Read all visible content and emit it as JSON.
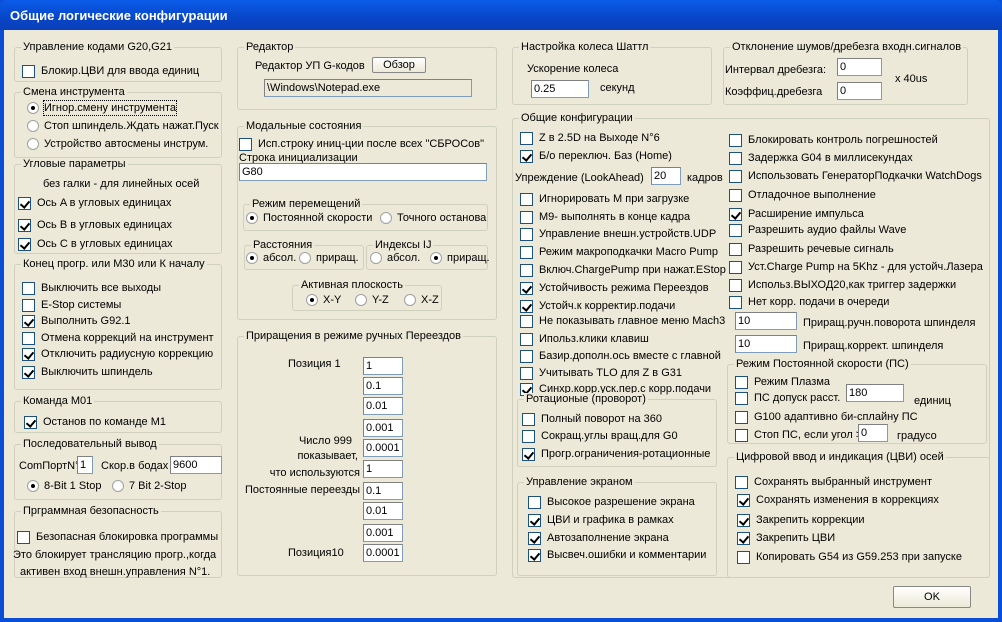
{
  "window": {
    "title": "Общие логические конфигурации"
  },
  "g20": {
    "title": "Управление кодами G20,G21",
    "items": [
      {
        "label": "Блокир.ЦВИ для ввода единиц",
        "checked": false
      }
    ]
  },
  "tool": {
    "title": "Смена инструмента",
    "items": [
      {
        "label": "Игнор.смену инструмента",
        "checked": true
      },
      {
        "label": "Стоп шпиндель.Ждать нажат.Пуск",
        "checked": false
      },
      {
        "label": "Устройство автосмены инструм.",
        "checked": false
      }
    ]
  },
  "angular": {
    "title": "Угловые параметры",
    "subtitle": "без галки - для линейных осей",
    "items": [
      {
        "label": "Ось A в угловых единицах",
        "checked": true
      },
      {
        "label": "Ось B в угловых единицах",
        "checked": true
      },
      {
        "label": "Ось C в угловых единицах",
        "checked": true
      }
    ]
  },
  "endprog": {
    "title": "Конец прогр. или M30 или К началу",
    "items": [
      {
        "label": "Выключить все выходы",
        "checked": false
      },
      {
        "label": "E-Stop системы",
        "checked": false
      },
      {
        "label": "Выполнить G92.1",
        "checked": true
      },
      {
        "label": "Отмена коррекций на инструмент",
        "checked": false
      },
      {
        "label": "Отключить радиусную коррекцию",
        "checked": true
      },
      {
        "label": "Выключить шпиндель",
        "checked": true
      }
    ]
  },
  "m01": {
    "title": "Команда M01",
    "items": [
      {
        "label": "Останов по команде M1",
        "checked": true
      }
    ]
  },
  "serial": {
    "title": "Последовательный вывод",
    "port_label": "ComПортN°",
    "port": "1",
    "baud_label": "Скор.в бодах",
    "baud": "9600",
    "items": [
      {
        "label": "8-Bit 1 Stop",
        "checked": true
      },
      {
        "label": "7 Bit 2-Stop",
        "checked": false
      }
    ]
  },
  "security": {
    "title": "Прграммная безопасность",
    "items": [
      {
        "label": "Безопасная блокировка программы",
        "checked": false
      }
    ],
    "note1": "Это блокирует трансляцию прогр.,когда",
    "note2": "активен вход внешн.управления N°1."
  },
  "editor": {
    "title": "Редактор",
    "label": "Редактор УП G-кодов",
    "browse": "Обзор",
    "path": "\\Windows\\Notepad.exe"
  },
  "modal": {
    "title": "Модальные состояния",
    "items": [
      {
        "label": "Исп.строку иниц-ции после всех \"СБРОСов\"",
        "checked": false
      }
    ],
    "init_label": "Строка инициализации",
    "init": "G80",
    "motion": {
      "title": "Режим перемещений",
      "items": [
        {
          "label": "Постоянной скорости",
          "checked": true
        },
        {
          "label": "Точного останова",
          "checked": false
        }
      ]
    },
    "dist": {
      "title": "Расстояния",
      "items": [
        {
          "label": "абсол.",
          "checked": true
        },
        {
          "label": "приращ.",
          "checked": false
        }
      ]
    },
    "ij": {
      "title": "Индексы IJ",
      "items": [
        {
          "label": "абсол.",
          "checked": false
        },
        {
          "label": "приращ.",
          "checked": true
        }
      ]
    },
    "plane": {
      "title": "Активная плоскость",
      "items": [
        {
          "label": "X-Y",
          "checked": true
        },
        {
          "label": "Y-Z",
          "checked": false
        },
        {
          "label": "X-Z",
          "checked": false
        }
      ]
    }
  },
  "jog": {
    "title": "Приращения в режиме ручных Переездов",
    "pos1": "Позиция 1",
    "note": [
      "Число 999",
      "показывает,",
      "что используются",
      "Постоянные переезды"
    ],
    "pos10": "Позиция10",
    "values": [
      "1",
      "0.1",
      "0.01",
      "0.001",
      "0.0001",
      "1",
      "0.1",
      "0.01",
      "0.001",
      "0.0001"
    ]
  },
  "shuttle": {
    "title": "Настройка колеса Шаттл",
    "label": "Ускорение колеса",
    "value": "0.25",
    "unit": "секунд"
  },
  "debounce": {
    "title": "Отклонение шумов/дребезга входн.сигналов",
    "interval_label": "Интервал дребезга:",
    "interval": "0",
    "coef_label": "Коэффиц.дребезга",
    "coef": "0",
    "unit": "x 40us"
  },
  "general": {
    "title": "Общие конфигурации",
    "left": [
      {
        "label": "Z в 2.5D на Выходе N°6",
        "checked": false
      },
      {
        "label": "Б/о переключ. Баз (Home)",
        "checked": true
      },
      {
        "label": "Игнорировать M при загрузке",
        "checked": false
      },
      {
        "label": "M9- выполнять в конце кадра",
        "checked": false
      },
      {
        "label": "Управление внешн.устройств.UDP",
        "checked": false
      },
      {
        "label": "Режим макроподкачки Macro Pump",
        "checked": false
      },
      {
        "label": "Включ.ChargePump при нажат.EStop",
        "checked": false
      },
      {
        "label": "Устойчивость режима Переездов",
        "checked": true
      },
      {
        "label": "Устойч.к корректир.подачи",
        "checked": true
      },
      {
        "label": "Не показывать главное меню Mach3",
        "checked": false
      },
      {
        "label": "Ипольз.клики клавиш",
        "checked": false
      },
      {
        "label": "Базир.дополн.ось вместе с главной",
        "checked": false
      },
      {
        "label": "Учитывать TLO для Z в G31",
        "checked": false
      },
      {
        "label": "Синхр.корр.уск.пер.с корр.подачи",
        "checked": true
      }
    ],
    "lookahead_label": "Упреждение (LookAhead)",
    "lookahead": "20",
    "lookahead_unit": "кадров",
    "right": [
      {
        "label": "Блокировать контроль погрешностей",
        "checked": false
      },
      {
        "label": "Задержка G04 в миллисекундах",
        "checked": false
      },
      {
        "label": "Использовать ГенераторПодкачки WatchDogs",
        "checked": false
      },
      {
        "label": "Отладочное выполнение",
        "checked": false
      },
      {
        "label": "Расширение импульса",
        "checked": true
      },
      {
        "label": "Разрешить аудио файлы Wave",
        "checked": false
      },
      {
        "label": "Разрешить речевые сигналь",
        "checked": false
      },
      {
        "label": "Уст.Charge Pump на 5Khz - для устойч.Лазера",
        "checked": false
      },
      {
        "label": "Использ.ВЫХОД20,как триггер задержки",
        "checked": false
      },
      {
        "label": "Нет корр. подачи в очереди",
        "checked": false
      }
    ],
    "spindle_jog": "10",
    "spindle_jog_label": "Приращ.ручн.поворота шпинделя",
    "spindle_ovr": "10",
    "spindle_ovr_label": "Приращ.коррект. шпинделя"
  },
  "rot": {
    "title": "Ротационые (проворот)",
    "items": [
      {
        "label": "Полный поворот на 360",
        "checked": false
      },
      {
        "label": "Сокращ.углы вращ.для G0",
        "checked": false
      },
      {
        "label": "Прогр.ограничения-ротационные",
        "checked": true
      }
    ]
  },
  "screen": {
    "title": "Управление экраном",
    "items": [
      {
        "label": "Высокое разрешение экрана",
        "checked": false
      },
      {
        "label": "ЦВИ и графика в рамках",
        "checked": true
      },
      {
        "label": "Автозаполнение экрана",
        "checked": true
      },
      {
        "label": "Высвеч.ошибки и комментарии",
        "checked": true
      }
    ]
  },
  "cv": {
    "title": "Режим Постоянной скорости (ПС)",
    "items": [
      {
        "label": "Режим Плазма",
        "checked": false
      },
      {
        "label": "ПС допуск расст.",
        "checked": false
      },
      {
        "label": "G100 адаптивно би-сплайну ПС",
        "checked": false
      },
      {
        "label": "Стоп ПС, если угол >",
        "checked": false
      }
    ],
    "dist": "180",
    "dist_unit": "единиц",
    "angle": "0",
    "angle_unit": "градусо"
  },
  "dro": {
    "title": "Цифровой ввод и индикация (ЦВИ) осей",
    "items": [
      {
        "label": "Сохранять выбранный инструмент",
        "checked": false
      },
      {
        "label": "Сохранять изменения в коррекциях",
        "checked": true
      },
      {
        "label": "Закрепить коррекции",
        "checked": true
      },
      {
        "label": "Закрепить ЦВИ",
        "checked": true
      },
      {
        "label": "Копировать G54 из G59.253 при запуске",
        "checked": false
      }
    ]
  },
  "ok": "OK"
}
